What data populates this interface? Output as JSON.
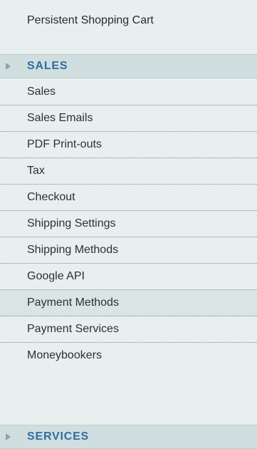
{
  "sidebar": {
    "top_item": "Persistent Shopping Cart",
    "sections": [
      {
        "title": "SALES",
        "items": [
          {
            "label": "Sales"
          },
          {
            "label": "Sales Emails"
          },
          {
            "label": "PDF Print-outs"
          },
          {
            "label": "Tax"
          },
          {
            "label": "Checkout"
          },
          {
            "label": "Shipping Settings"
          },
          {
            "label": "Shipping Methods"
          },
          {
            "label": "Google API"
          },
          {
            "label": "Payment Methods",
            "active": true
          },
          {
            "label": "Payment Services"
          },
          {
            "label": "Moneybookers"
          }
        ]
      },
      {
        "title": "SERVICES",
        "items": []
      }
    ]
  },
  "colors": {
    "background": "#e7efef",
    "section_header_bg": "#d1dedf",
    "section_title": "#2e6ea2",
    "active_item_bg": "#d9e4e4"
  },
  "icons": {
    "section_toggle": "triangle-right-icon"
  }
}
